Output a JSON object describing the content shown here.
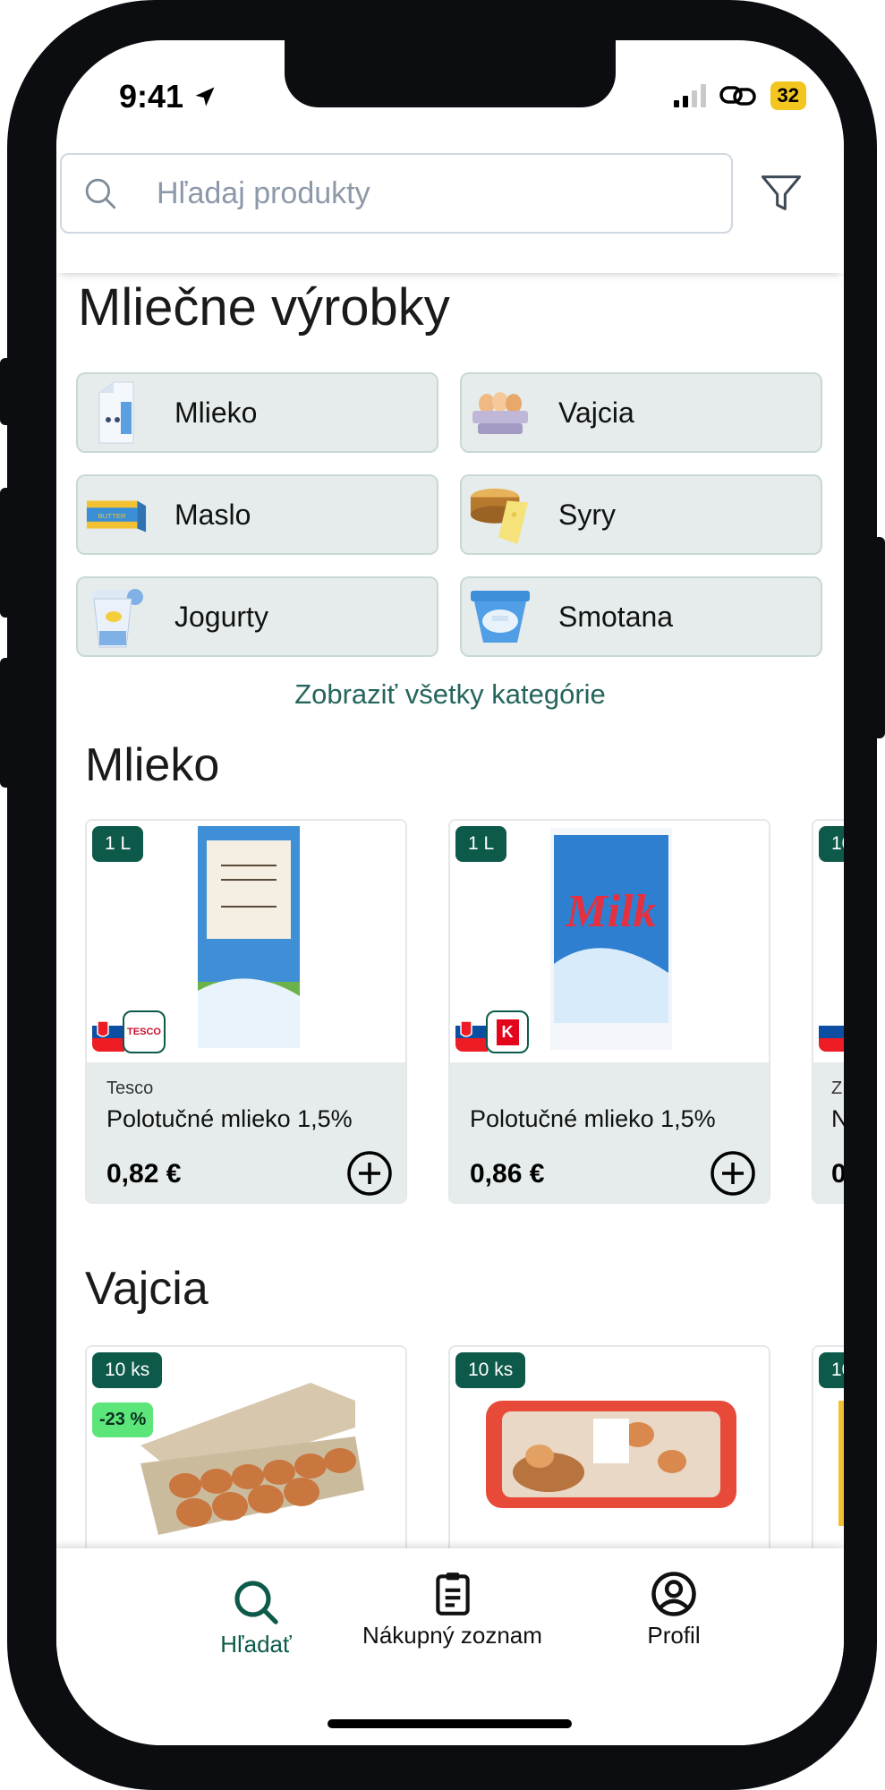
{
  "status_bar": {
    "time": "9:41",
    "battery": "32"
  },
  "search": {
    "placeholder": "Hľadaj produkty"
  },
  "categories": {
    "title": "Mliečne výrobky",
    "items": [
      {
        "label": "Mlieko",
        "icon": "milk-carton-icon"
      },
      {
        "label": "Vajcia",
        "icon": "eggs-icon"
      },
      {
        "label": "Maslo",
        "icon": "butter-icon"
      },
      {
        "label": "Syry",
        "icon": "cheese-icon"
      },
      {
        "label": "Jogurty",
        "icon": "yogurt-icon"
      },
      {
        "label": "Smotana",
        "icon": "cream-icon"
      }
    ],
    "show_all": "Zobraziť všetky kategórie"
  },
  "sections": [
    {
      "title": "Mlieko",
      "products": [
        {
          "size": "1 L",
          "store": "Tesco",
          "store_logo": "TESCO",
          "name": "Polotučné mlieko 1,5%",
          "price": "0,82 €"
        },
        {
          "size": "1 L",
          "store": "",
          "store_logo": "K",
          "name": "Polotučné mlieko 1,5%",
          "price": "0,86 €",
          "package_text": "Milk"
        },
        {
          "size": "10",
          "store": "Z",
          "name": "N",
          "price": "0"
        }
      ]
    },
    {
      "title": "Vajcia",
      "products": [
        {
          "size": "10 ks",
          "discount": "-23 %"
        },
        {
          "size": "10 ks"
        },
        {
          "size": "10"
        }
      ]
    }
  ],
  "tabbar": {
    "items": [
      {
        "label": "Hľadať",
        "icon": "search-icon",
        "active": true
      },
      {
        "label": "Nákupný zoznam",
        "icon": "clipboard-icon",
        "active": false
      },
      {
        "label": "Profil",
        "icon": "profile-icon",
        "active": false
      }
    ]
  },
  "colors": {
    "accent": "#0d5a4a",
    "link": "#25655c",
    "tile": "#e6ecec",
    "discount": "#5ce67a"
  }
}
